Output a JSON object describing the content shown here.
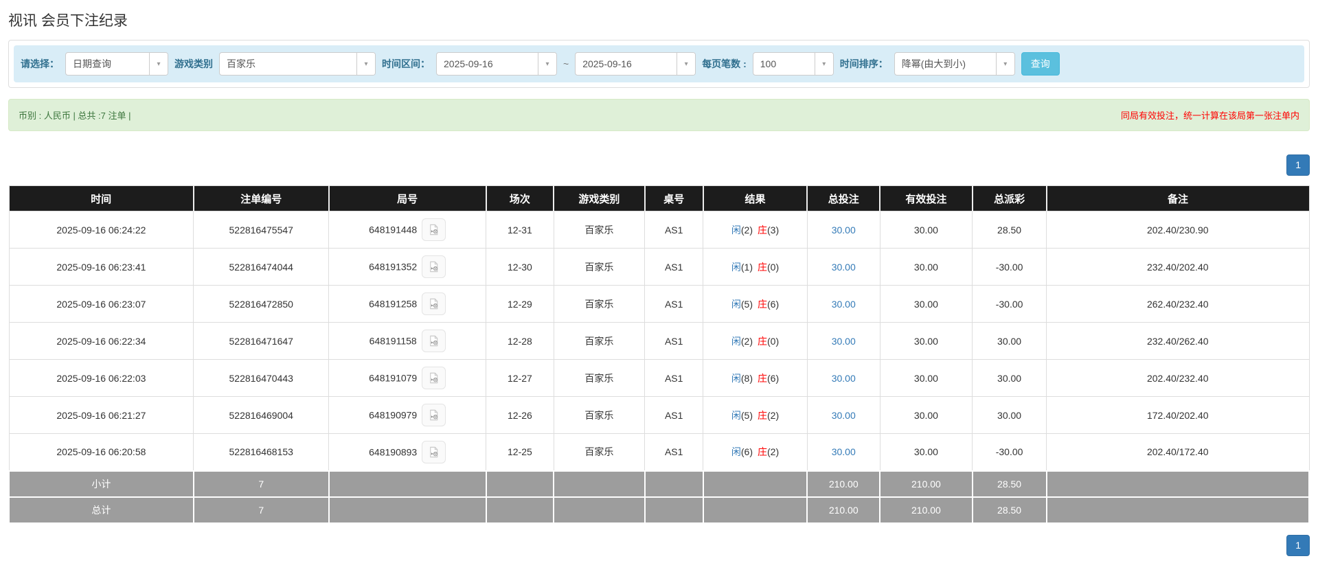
{
  "page": {
    "title": "视讯 会员下注纪录"
  },
  "filters": {
    "select_label": "请选择：",
    "select_value": "日期查询",
    "game_type_label": "游戏类别",
    "game_type_value": "百家乐",
    "date_range_label": "时间区间：",
    "date_from": "2025-09-16",
    "range_separator": "~",
    "date_to": "2025-09-16",
    "page_size_label": "每页笔数 :",
    "page_size_value": "100",
    "sort_label": "时间排序：",
    "sort_value": "降幂(由大到小)",
    "search_button": "查询"
  },
  "summary_bar": {
    "left_text": "币别 : 人民币 | 总共 :7 注单 |",
    "right_text": "同局有效投注，统一计算在该局第一张注单内"
  },
  "pagination": {
    "page": "1"
  },
  "icons": {
    "dropdown_arrow": "▾",
    "video": "video-file"
  },
  "colors": {
    "header_bg": "#1c1c1c",
    "summary_row_bg": "#9d9d9d",
    "link_blue": "#337ab7",
    "player_blue": "#337ab7",
    "banker_red": "#ff0000",
    "negative_red": "#ff0000",
    "filter_bg": "#d9edf7",
    "filter_label": "#31708f",
    "notice_bg": "#dff0d8",
    "notice_text": "#3c763d",
    "notice_warning": "#ff0000",
    "search_button_bg": "#5bc0de",
    "pagination_bg": "#337ab7"
  },
  "table": {
    "headers": [
      "时间",
      "注单编号",
      "局号",
      "场次",
      "游戏类别",
      "桌号",
      "结果",
      "总投注",
      "有效投注",
      "总派彩",
      "备注"
    ],
    "rows": [
      {
        "time": "2025-09-16 06:24:22",
        "bet_id": "522816475547",
        "round_id": "648191448",
        "session": "12-31",
        "game": "百家乐",
        "table_no": "AS1",
        "player_label": "闲",
        "player_score": "(2)",
        "banker_label": "庄",
        "banker_score": "(3)",
        "total_bet": "30.00",
        "valid_bet": "30.00",
        "payout": "28.50",
        "remark": "202.40/230.90"
      },
      {
        "time": "2025-09-16 06:23:41",
        "bet_id": "522816474044",
        "round_id": "648191352",
        "session": "12-30",
        "game": "百家乐",
        "table_no": "AS1",
        "player_label": "闲",
        "player_score": "(1)",
        "banker_label": "庄",
        "banker_score": "(0)",
        "total_bet": "30.00",
        "valid_bet": "30.00",
        "payout": "-30.00",
        "remark": "232.40/202.40"
      },
      {
        "time": "2025-09-16 06:23:07",
        "bet_id": "522816472850",
        "round_id": "648191258",
        "session": "12-29",
        "game": "百家乐",
        "table_no": "AS1",
        "player_label": "闲",
        "player_score": "(5)",
        "banker_label": "庄",
        "banker_score": "(6)",
        "total_bet": "30.00",
        "valid_bet": "30.00",
        "payout": "-30.00",
        "remark": "262.40/232.40"
      },
      {
        "time": "2025-09-16 06:22:34",
        "bet_id": "522816471647",
        "round_id": "648191158",
        "session": "12-28",
        "game": "百家乐",
        "table_no": "AS1",
        "player_label": "闲",
        "player_score": "(2)",
        "banker_label": "庄",
        "banker_score": "(0)",
        "total_bet": "30.00",
        "valid_bet": "30.00",
        "payout": "30.00",
        "remark": "232.40/262.40"
      },
      {
        "time": "2025-09-16 06:22:03",
        "bet_id": "522816470443",
        "round_id": "648191079",
        "session": "12-27",
        "game": "百家乐",
        "table_no": "AS1",
        "player_label": "闲",
        "player_score": "(8)",
        "banker_label": "庄",
        "banker_score": "(6)",
        "total_bet": "30.00",
        "valid_bet": "30.00",
        "payout": "30.00",
        "remark": "202.40/232.40"
      },
      {
        "time": "2025-09-16 06:21:27",
        "bet_id": "522816469004",
        "round_id": "648190979",
        "session": "12-26",
        "game": "百家乐",
        "table_no": "AS1",
        "player_label": "闲",
        "player_score": "(5)",
        "banker_label": "庄",
        "banker_score": "(2)",
        "total_bet": "30.00",
        "valid_bet": "30.00",
        "payout": "30.00",
        "remark": "172.40/202.40"
      },
      {
        "time": "2025-09-16 06:20:58",
        "bet_id": "522816468153",
        "round_id": "648190893",
        "session": "12-25",
        "game": "百家乐",
        "table_no": "AS1",
        "player_label": "闲",
        "player_score": "(6)",
        "banker_label": "庄",
        "banker_score": "(2)",
        "total_bet": "30.00",
        "valid_bet": "30.00",
        "payout": "-30.00",
        "remark": "202.40/172.40"
      }
    ],
    "subtotal": {
      "label": "小计",
      "count": "7",
      "total_bet": "210.00",
      "valid_bet": "210.00",
      "payout": "28.50"
    },
    "total": {
      "label": "总计",
      "count": "7",
      "total_bet": "210.00",
      "valid_bet": "210.00",
      "payout": "28.50"
    }
  }
}
